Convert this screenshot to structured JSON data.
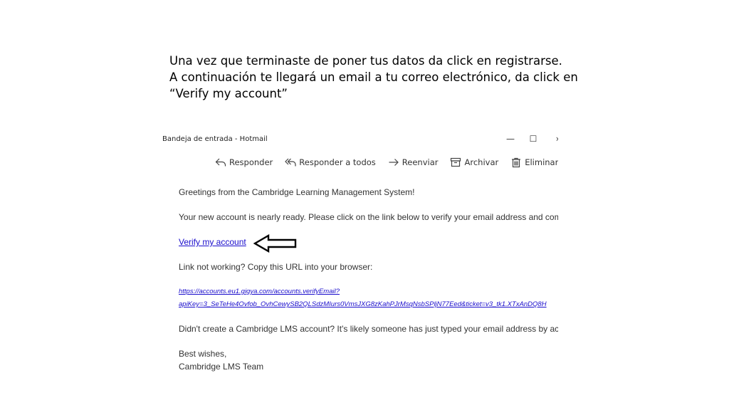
{
  "instructions": {
    "line1": "Una vez que terminaste de poner tus datos da  click en registrarse.",
    "line2": "A continuación te llegará un email a tu correo electrónico, da click en",
    "line3": "“Verify my account”"
  },
  "window": {
    "title": "Bandeja de entrada - Hotmail",
    "minimize_glyph": "—",
    "maximize_glyph": "☐",
    "more_glyph": "›"
  },
  "toolbar": {
    "reply_label": "Responder",
    "reply_all_label": "Responder a todos",
    "forward_label": "Reenviar",
    "archive_label": "Archivar",
    "delete_label": "Eliminar",
    "more_label": "•••"
  },
  "email": {
    "greeting": "Greetings from the Cambridge Learning Management System!",
    "account_ready": "Your new account is nearly ready. Please click on the link below to verify your email address and comp",
    "verify_link": "Verify my account",
    "link_not_working": "Link not working? Copy this URL into your browser:",
    "url_line1": "https://accounts.eu1.gigya.com/accounts.verifyEmail?",
    "url_line2": "apiKey=3_SeTeHe4Ovfob_OvhCewySB2QLSdzMIurs0VmsJXG8zKahPJrMsqNsbSPljN77Eed&ticket=v3_tk1.XTxAnDQ8H",
    "didnt_create": "Didn't create a Cambridge LMS account? It's likely someone has just typed your email address by acc",
    "sign_off": "Best wishes,",
    "team": "Cambridge LMS Team"
  },
  "icons": {
    "reply": "reply-icon",
    "reply_all": "reply-all-icon",
    "forward": "forward-icon",
    "archive": "archive-icon",
    "delete": "trash-icon",
    "pointer": "left-arrow-icon"
  }
}
